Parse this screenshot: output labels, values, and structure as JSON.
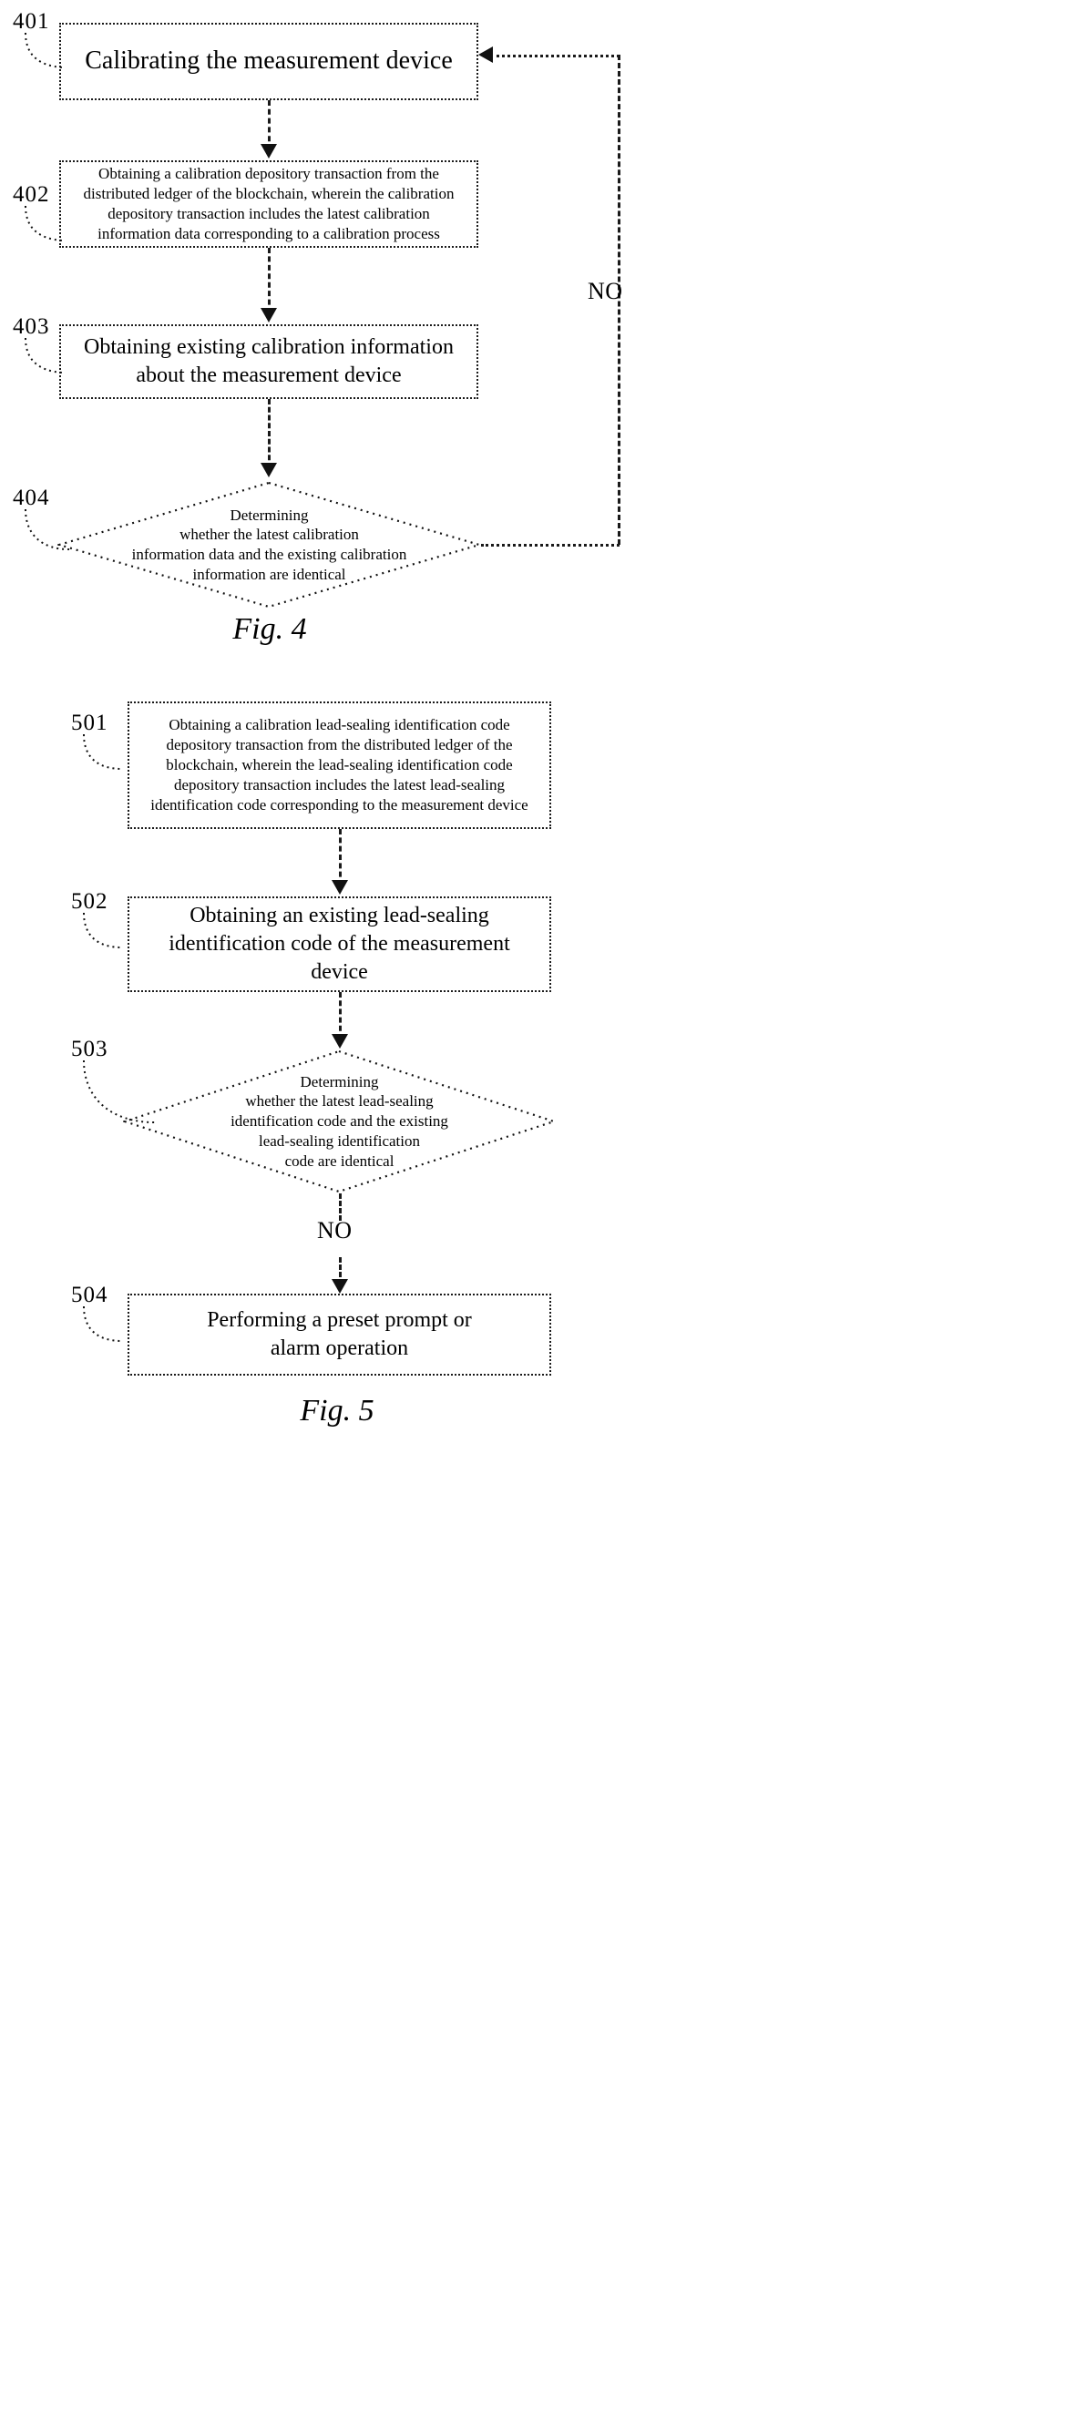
{
  "figures": [
    {
      "id": "fig4",
      "caption": "Fig. 4",
      "nodes": [
        {
          "ref": "401",
          "text": "Calibrating the measurement device",
          "shape": "process"
        },
        {
          "ref": "402",
          "text": "Obtaining a calibration depository transaction from the distributed ledger of the blockchain, wherein the calibration depository transaction includes the latest calibration information data corresponding to a calibration process",
          "shape": "process"
        },
        {
          "ref": "403",
          "text": "Obtaining existing calibration information about the measurement device",
          "shape": "process"
        },
        {
          "ref": "404",
          "text": "Determining whether the latest calibration information data and the existing calibration information are identical",
          "shape": "decision"
        }
      ],
      "branch_labels": [
        "NO"
      ]
    },
    {
      "id": "fig5",
      "caption": "Fig. 5",
      "nodes": [
        {
          "ref": "501",
          "text": "Obtaining a calibration lead-sealing identification code depository transaction from the distributed ledger of the blockchain, wherein the lead-sealing identification code depository transaction includes the latest lead-sealing identification code corresponding to the measurement device",
          "shape": "process"
        },
        {
          "ref": "502",
          "text": "Obtaining an existing lead-sealing identification code of the measurement device",
          "shape": "process"
        },
        {
          "ref": "503",
          "text": "Determining whether the latest lead-sealing identification code and the existing lead-sealing identification code are identical",
          "shape": "decision"
        },
        {
          "ref": "504",
          "text": "Performing a preset prompt or alarm operation",
          "shape": "process"
        }
      ],
      "branch_labels": [
        "NO"
      ]
    }
  ],
  "fig4": {
    "ref_401": "401",
    "ref_402": "402",
    "ref_403": "403",
    "ref_404": "404",
    "box_401": "Calibrating the measurement device",
    "box_402_line1": "Obtaining a calibration depository transaction from the",
    "box_402_line2": "distributed ledger of the blockchain, wherein the calibration",
    "box_402_line3": "depository transaction includes the latest calibration",
    "box_402_line4": "information data corresponding to a calibration process",
    "box_403_line1": "Obtaining existing calibration information",
    "box_403_line2": "about the measurement device",
    "dia_404_line1": "Determining",
    "dia_404_line2": "whether the latest calibration",
    "dia_404_line3": "information data and the existing calibration",
    "dia_404_line4": "information are identical",
    "no_label": "NO",
    "caption": "Fig. 4"
  },
  "fig5": {
    "ref_501": "501",
    "ref_502": "502",
    "ref_503": "503",
    "ref_504": "504",
    "box_501_line1": "Obtaining a calibration lead-sealing identification code",
    "box_501_line2": "depository transaction from the distributed ledger of the",
    "box_501_line3": "blockchain, wherein the lead-sealing identification code",
    "box_501_line4": "depository transaction includes the latest lead-sealing",
    "box_501_line5": "identification code corresponding to the measurement device",
    "box_502_line1": "Obtaining an existing lead-sealing",
    "box_502_line2": "identification code of the measurement",
    "box_502_line3": "device",
    "dia_503_line1": "Determining",
    "dia_503_line2": "whether the latest lead-sealing",
    "dia_503_line3": "identification code and the existing",
    "dia_503_line4": "lead-sealing identification",
    "dia_503_line5": "code are identical",
    "no_label": "NO",
    "box_504_line1": "Performing a preset prompt or",
    "box_504_line2": "alarm operation",
    "caption": "Fig. 5"
  },
  "colors": {
    "ink": "#000000",
    "background": "#ffffff"
  }
}
